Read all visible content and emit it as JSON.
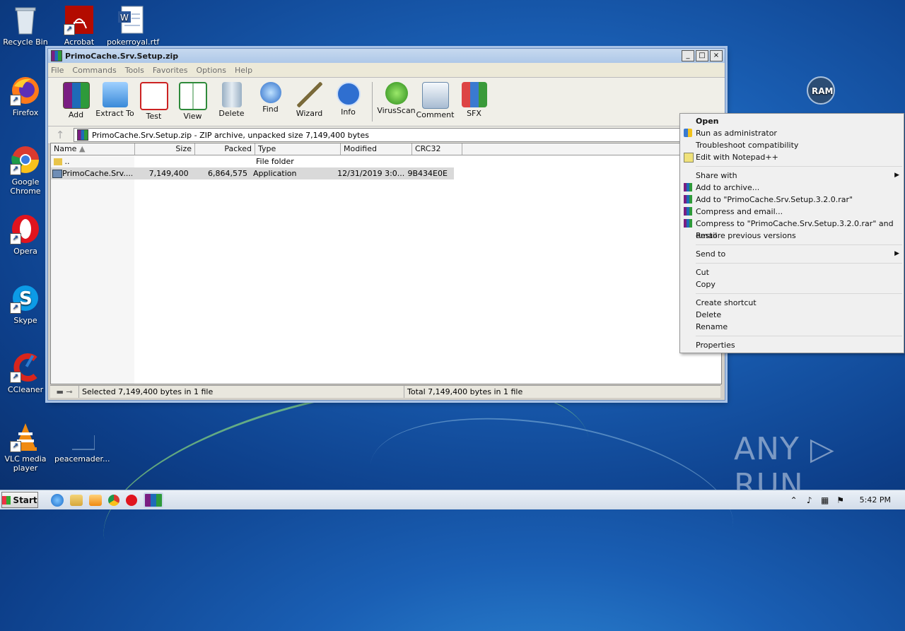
{
  "desktop": {
    "icons": [
      {
        "label": "Recycle Bin"
      },
      {
        "label": "Acrobat"
      },
      {
        "label": "pokerroyal.rtf"
      },
      {
        "label": "Firefox"
      },
      {
        "label": "Google Chrome"
      },
      {
        "label": "Opera"
      },
      {
        "label": "Skype"
      },
      {
        "label": "CCleaner"
      },
      {
        "label": "VLC media player"
      },
      {
        "label": "peacemader..."
      },
      {
        "label": "RAM"
      }
    ]
  },
  "window": {
    "title": "PrimoCache.Srv.Setup.zip",
    "min": "_",
    "max": "□",
    "close": "×",
    "menu": [
      "File",
      "Commands",
      "Tools",
      "Favorites",
      "Options",
      "Help"
    ],
    "toolbar": [
      {
        "label": "Add",
        "icon": "add-archive-icon"
      },
      {
        "label": "Extract To",
        "icon": "extract-folder-icon"
      },
      {
        "label": "Test",
        "icon": "test-clipboard-icon"
      },
      {
        "label": "View",
        "icon": "view-book-icon"
      },
      {
        "label": "Delete",
        "icon": "trash-bin-icon"
      },
      {
        "label": "Find",
        "icon": "magnifier-icon"
      },
      {
        "label": "Wizard",
        "icon": "magic-wand-icon"
      },
      {
        "label": "Info",
        "icon": "info-icon"
      },
      {
        "label": "VirusScan",
        "icon": "virus-scan-icon"
      },
      {
        "label": "Comment",
        "icon": "comment-icon"
      },
      {
        "label": "SFX",
        "icon": "sfx-box-icon"
      }
    ],
    "address": "PrimoCache.Srv.Setup.zip - ZIP archive, unpacked size 7,149,400 bytes",
    "columns": [
      "Name",
      "Size",
      "Packed",
      "Type",
      "Modified",
      "CRC32"
    ],
    "rows": [
      {
        "name": "..",
        "size": "",
        "packed": "",
        "type": "File folder",
        "modified": "",
        "crc": ""
      },
      {
        "name": "PrimoCache.Srv....",
        "size": "7,149,400",
        "packed": "6,864,575",
        "type": "Application",
        "modified": "12/31/2019 3:0...",
        "crc": "9B434E0E"
      }
    ],
    "status_left": "Selected 7,149,400 bytes in 1 file",
    "status_right": "Total 7,149,400 bytes in 1 file"
  },
  "context_menu": {
    "open": "Open",
    "run_admin": "Run as administrator",
    "troubleshoot": "Troubleshoot compatibility",
    "notepad": "Edit with Notepad++",
    "share_with": "Share with",
    "add_archive": "Add to archive...",
    "add_rar": "Add to \"PrimoCache.Srv.Setup.3.2.0.rar\"",
    "compress_email": "Compress and email...",
    "compress_rar_email": "Compress to \"PrimoCache.Srv.Setup.3.2.0.rar\" and email",
    "restore": "Restore previous versions",
    "send_to": "Send to",
    "cut": "Cut",
    "copy": "Copy",
    "create_shortcut": "Create shortcut",
    "delete": "Delete",
    "rename": "Rename",
    "properties": "Properties"
  },
  "taskbar": {
    "start": "Start",
    "clock": "5:42 PM"
  },
  "watermark": "ANY ▷ RUN"
}
